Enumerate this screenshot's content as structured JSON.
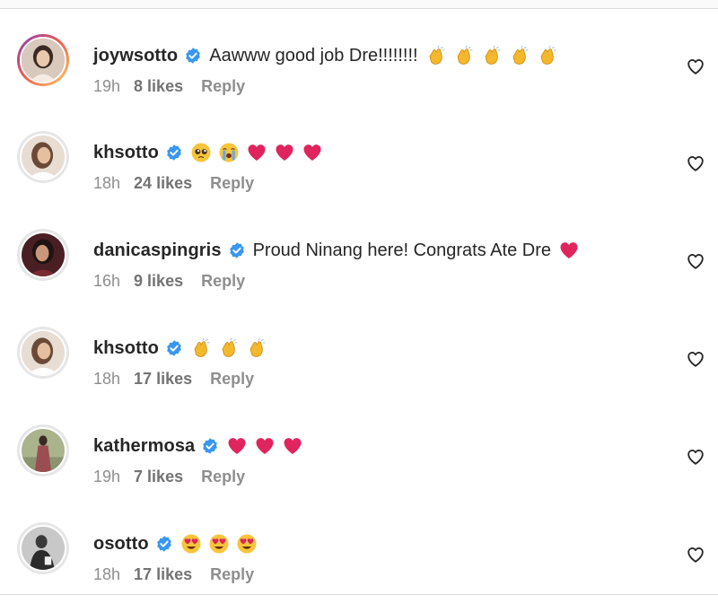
{
  "comments": [
    {
      "username": "joywsotto",
      "verified": true,
      "text": "Aawww good job Dre!!!!!!!!",
      "emojis": [
        "clap",
        "clap",
        "clap",
        "clap",
        "clap"
      ],
      "time": "19h",
      "likes": "8 likes",
      "reply": "Reply",
      "avatar": "woman-portrait",
      "story_ring": true
    },
    {
      "username": "khsotto",
      "verified": true,
      "text": "",
      "emojis": [
        "pleading-face",
        "crying-face",
        "red-heart",
        "red-heart",
        "red-heart"
      ],
      "time": "18h",
      "likes": "24 likes",
      "reply": "Reply",
      "avatar": "woman-portrait",
      "story_ring": false
    },
    {
      "username": "danicaspingris",
      "verified": true,
      "text": "Proud Ninang here! Congrats Ate Dre",
      "emojis": [
        "red-heart"
      ],
      "time": "16h",
      "likes": "9 likes",
      "reply": "Reply",
      "avatar": "woman-portrait-dark",
      "story_ring": false
    },
    {
      "username": "khsotto",
      "verified": true,
      "text": "",
      "emojis": [
        "clap",
        "clap",
        "clap"
      ],
      "time": "18h",
      "likes": "17 likes",
      "reply": "Reply",
      "avatar": "woman-portrait",
      "story_ring": false
    },
    {
      "username": "kathermosa",
      "verified": true,
      "text": "",
      "emojis": [
        "red-heart",
        "red-heart",
        "red-heart"
      ],
      "time": "19h",
      "likes": "7 likes",
      "reply": "Reply",
      "avatar": "woman-outdoor",
      "story_ring": false
    },
    {
      "username": "osotto",
      "verified": true,
      "text": "",
      "emojis": [
        "heart-eyes",
        "heart-eyes",
        "heart-eyes"
      ],
      "time": "18h",
      "likes": "17 likes",
      "reply": "Reply",
      "avatar": "man-bw",
      "story_ring": false
    }
  ],
  "colors": {
    "verified": "#3897f0",
    "meta_text": "#8e8e8e",
    "heart_emoji": "#e0245e"
  }
}
